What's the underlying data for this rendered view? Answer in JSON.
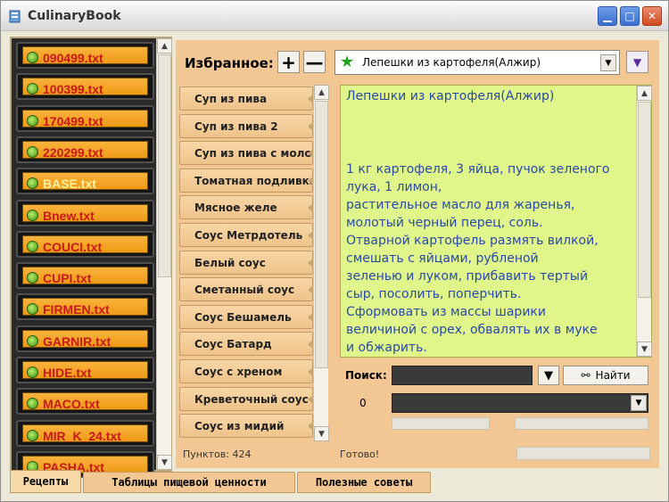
{
  "window": {
    "title": "CulinaryBook",
    "minimize_icon": "minimize-icon",
    "maximize_icon": "maximize-icon",
    "close_icon": "close-icon"
  },
  "files": [
    {
      "name": "090499.txt",
      "selected": false
    },
    {
      "name": "100399.txt",
      "selected": false
    },
    {
      "name": "170499.txt",
      "selected": false
    },
    {
      "name": "220299.txt",
      "selected": false
    },
    {
      "name": "BASE.txt",
      "selected": true
    },
    {
      "name": "Bnew.txt",
      "selected": false
    },
    {
      "name": "COUCI.txt",
      "selected": false
    },
    {
      "name": "CUPI.txt",
      "selected": false
    },
    {
      "name": "FIRMEN.txt",
      "selected": false
    },
    {
      "name": "GARNIR.txt",
      "selected": false
    },
    {
      "name": "HIDE.txt",
      "selected": false
    },
    {
      "name": "MACO.txt",
      "selected": false
    },
    {
      "name": "MIR_K_24.txt",
      "selected": false
    },
    {
      "name": "PASHA.txt",
      "selected": false
    }
  ],
  "favorites": {
    "label": "Избранное:",
    "add_label": "+",
    "remove_label": "—",
    "selected": "Лепешки из картофеля(Алжир)"
  },
  "recipes": [
    "Суп из пива",
    "Суп из пива 2",
    "Суп из пива с моло",
    "Томатная подливка",
    "Мясное желе",
    "Соус Метрдотель",
    "Белый соус",
    "Сметанный соус",
    "Соус Бешамель",
    "Соус Батард",
    "Соус с хреном",
    "Креветочный соус",
    "Соус из мидий"
  ],
  "recipe_view": {
    "title": "Лепешки из картофеля(Алжир)",
    "lines": [
      "1 кг картофеля, 3 яйца, пучок зеленого",
      "лука, 1 лимон,",
      "растительное масло для жаренья,",
      "молотый черный перец, соль.",
      "Отварной картофель размять вилкой,",
      "смешать с яйцами, рубленой",
      "зеленью и луком, прибавить тертый",
      "сыр, посолить, поперчить.",
      "Сформовать из массы шарики",
      "величиной с орех, обвалять их в муке",
      "и обжарить."
    ]
  },
  "search": {
    "label": "Поиск:",
    "query": "",
    "find_label": "Найти",
    "counter": "0",
    "result": ""
  },
  "status": {
    "count": "Пунктов: 424",
    "ready": "Готово!"
  },
  "tabs": [
    "Рецепты",
    "Таблицы пищевой ценности",
    "Полезные советы"
  ],
  "active_tab": "Рецепты"
}
